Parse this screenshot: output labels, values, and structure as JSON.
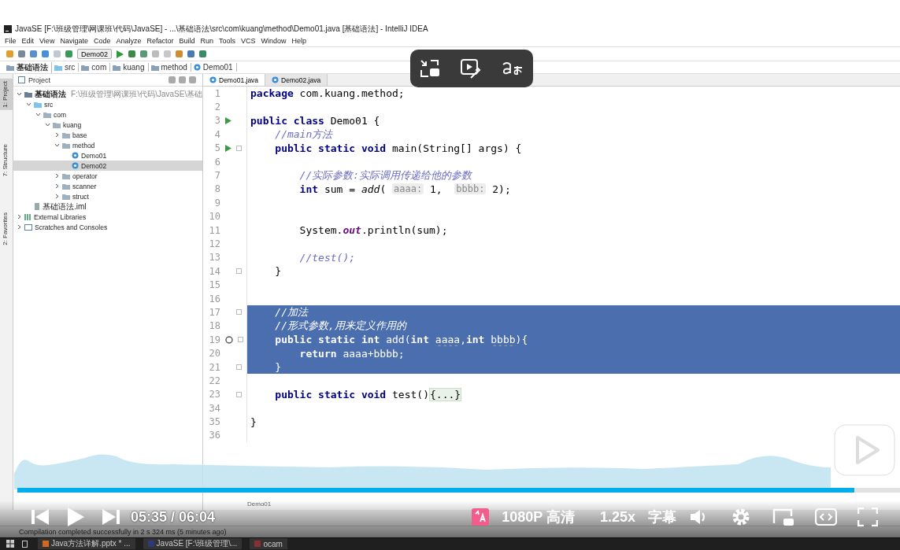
{
  "window": {
    "title": "JavaSE [F:\\班级管理\\网课班\\代码\\JavaSE] - ...\\基础语法\\src\\com\\kuang\\method\\Demo01.java [基础语法] - IntelliJ IDEA"
  },
  "menu": [
    "File",
    "Edit",
    "View",
    "Navigate",
    "Code",
    "Analyze",
    "Refactor",
    "Build",
    "Run",
    "Tools",
    "VCS",
    "Window",
    "Help"
  ],
  "run_config": "Demo02",
  "breadcrumb": [
    "基础语法",
    "src",
    "com",
    "kuang",
    "method",
    "Demo01"
  ],
  "side_tabs": [
    {
      "label": "1: Project",
      "selected": true
    },
    {
      "label": "7: Structure",
      "selected": false
    },
    {
      "label": "2: Favorites",
      "selected": false
    }
  ],
  "project": {
    "title": "Project",
    "tree": [
      {
        "label": "基础语法",
        "path": "F:\\班级管理\\网课班\\代码\\JavaSE\\基础",
        "kind": "module",
        "expanded": true,
        "selected": false,
        "children": [
          {
            "label": "src",
            "kind": "source",
            "expanded": true,
            "selected": false,
            "children": [
              {
                "label": "com",
                "kind": "folder",
                "expanded": true,
                "selected": false,
                "children": [
                  {
                    "label": "kuang",
                    "kind": "folder",
                    "expanded": true,
                    "selected": false,
                    "children": [
                      {
                        "label": "base",
                        "kind": "folder",
                        "expanded": false,
                        "selected": false
                      },
                      {
                        "label": "method",
                        "kind": "folder",
                        "expanded": true,
                        "selected": false,
                        "children": [
                          {
                            "label": "Demo01",
                            "kind": "class",
                            "selected": false
                          },
                          {
                            "label": "Demo02",
                            "kind": "class",
                            "selected": true
                          }
                        ]
                      },
                      {
                        "label": "operator",
                        "kind": "folder",
                        "expanded": false,
                        "selected": false
                      },
                      {
                        "label": "scanner",
                        "kind": "folder",
                        "expanded": false,
                        "selected": false
                      },
                      {
                        "label": "struct",
                        "kind": "folder",
                        "expanded": false,
                        "selected": false
                      }
                    ]
                  }
                ]
              }
            ]
          },
          {
            "label": "基础语法.iml",
            "kind": "file",
            "selected": false
          }
        ]
      },
      {
        "label": "External Libraries",
        "kind": "library",
        "expanded": false,
        "selected": false
      },
      {
        "label": "Scratches and Consoles",
        "kind": "scratch",
        "expanded": false,
        "selected": false
      }
    ]
  },
  "editor_tabs": [
    {
      "label": "Demo01.java",
      "selected": true
    },
    {
      "label": "Demo02.java",
      "selected": false
    }
  ],
  "code": [
    {
      "n": "1",
      "seg": [
        {
          "kind": "keyword",
          "text": "package"
        },
        {
          "kind": "plain",
          "text": " com.kuang.method;"
        }
      ]
    },
    {
      "n": "2"
    },
    {
      "n": "3",
      "run_icon": true,
      "seg": [
        {
          "kind": "keyword",
          "text": "public class"
        },
        {
          "kind": "plain",
          "text": " Demo01 {"
        }
      ]
    },
    {
      "n": "4",
      "seg": [
        {
          "kind": "comment",
          "text": "    //main方法"
        }
      ]
    },
    {
      "n": "5",
      "run_icon": true,
      "fold": true,
      "seg": [
        {
          "kind": "keyword",
          "text": "    public static void"
        },
        {
          "kind": "plain",
          "text": " main(String[] args) {"
        }
      ]
    },
    {
      "n": "6"
    },
    {
      "n": "7",
      "seg": [
        {
          "kind": "comment",
          "text": "        //实际参数:实际调用传递给他的参数"
        }
      ]
    },
    {
      "n": "8",
      "seg": [
        {
          "kind": "keyword",
          "text": "        int"
        },
        {
          "kind": "plain",
          "text": " sum = "
        },
        {
          "kind": "call",
          "text": "add"
        },
        {
          "kind": "plain",
          "text": "( "
        },
        {
          "kind": "hint",
          "text": "aaaa:"
        },
        {
          "kind": "plain",
          "text": " 1,  "
        },
        {
          "kind": "hint",
          "text": "bbbb:"
        },
        {
          "kind": "plain",
          "text": " 2);"
        }
      ]
    },
    {
      "n": "9"
    },
    {
      "n": "10"
    },
    {
      "n": "11",
      "seg": [
        {
          "kind": "plain",
          "text": "        System."
        },
        {
          "kind": "field",
          "text": "out"
        },
        {
          "kind": "plain",
          "text": ".println(sum);"
        }
      ]
    },
    {
      "n": "12"
    },
    {
      "n": "13",
      "seg": [
        {
          "kind": "comment",
          "text": "        //test();"
        }
      ]
    },
    {
      "n": "14",
      "fold": true,
      "seg": [
        {
          "kind": "plain",
          "text": "    }"
        }
      ]
    },
    {
      "n": "15"
    },
    {
      "n": "16"
    },
    {
      "n": "17",
      "selected": true,
      "fold": true,
      "seg": [
        {
          "kind": "comment",
          "text": "    //加法"
        }
      ]
    },
    {
      "n": "18",
      "selected": true,
      "seg": [
        {
          "kind": "comment",
          "text": "    //形式参数,用来定义作用的"
        }
      ]
    },
    {
      "n": "19",
      "selected": true,
      "override_icon": true,
      "fold": true,
      "seg": [
        {
          "kind": "keyword",
          "text": "    public static int"
        },
        {
          "kind": "plain",
          "text": " add("
        },
        {
          "kind": "keyword",
          "text": "int "
        },
        {
          "kind": "typo",
          "text": "aaaa"
        },
        {
          "kind": "plain",
          "text": ","
        },
        {
          "kind": "keyword",
          "text": "int "
        },
        {
          "kind": "typo",
          "text": "bbbb"
        },
        {
          "kind": "plain",
          "text": "){"
        }
      ]
    },
    {
      "n": "20",
      "selected": true,
      "seg": [
        {
          "kind": "keyword",
          "text": "        return"
        },
        {
          "kind": "plain",
          "text": " aaaa+bbbb;"
        }
      ]
    },
    {
      "n": "21",
      "selected": true,
      "fold": true,
      "seg": [
        {
          "kind": "plain",
          "text": "    }"
        }
      ]
    },
    {
      "n": "22"
    },
    {
      "n": "23",
      "fold": true,
      "seg": [
        {
          "kind": "keyword",
          "text": "    public static void"
        },
        {
          "kind": "plain",
          "text": " test()"
        },
        {
          "kind": "folded",
          "text": "{...}"
        }
      ]
    },
    {
      "n": "34"
    },
    {
      "n": "35",
      "seg": [
        {
          "kind": "plain",
          "text": "}"
        }
      ]
    },
    {
      "n": "36"
    }
  ],
  "editor_breadcrumb": "Demo01",
  "status": "Compilation completed successfully in 2 s 324 ms (5 minutes ago)",
  "taskbar": [
    "Java方法详解.pptx * ...",
    "JavaSE [F:\\班级管理\\...",
    "ocam"
  ],
  "player": {
    "level": 0.948,
    "time": "05:35 / 06:04",
    "quality": "1080P 高清",
    "speed": "1.25x",
    "subtitles": "字幕"
  }
}
